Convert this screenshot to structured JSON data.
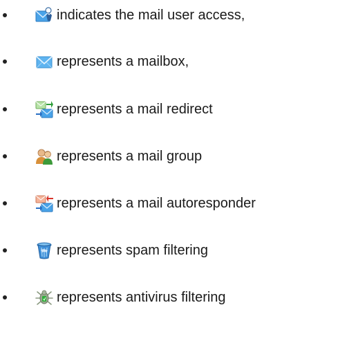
{
  "legend": {
    "items": [
      {
        "icon": "mail-user-access-icon",
        "text": "indicates the mail user access,"
      },
      {
        "icon": "mailbox-envelope-icon",
        "text": "represents a mailbox,"
      },
      {
        "icon": "mail-redirect-icon",
        "text": "represents a mail redirect"
      },
      {
        "icon": "mail-group-icon",
        "text": "represents a mail group"
      },
      {
        "icon": "mail-autoresponder-icon",
        "text": "represents a mail autoresponder"
      },
      {
        "icon": "spam-filter-trash-icon",
        "text": "represents spam filtering"
      },
      {
        "icon": "antivirus-bug-icon",
        "text": "represents antivirus filtering"
      }
    ]
  }
}
